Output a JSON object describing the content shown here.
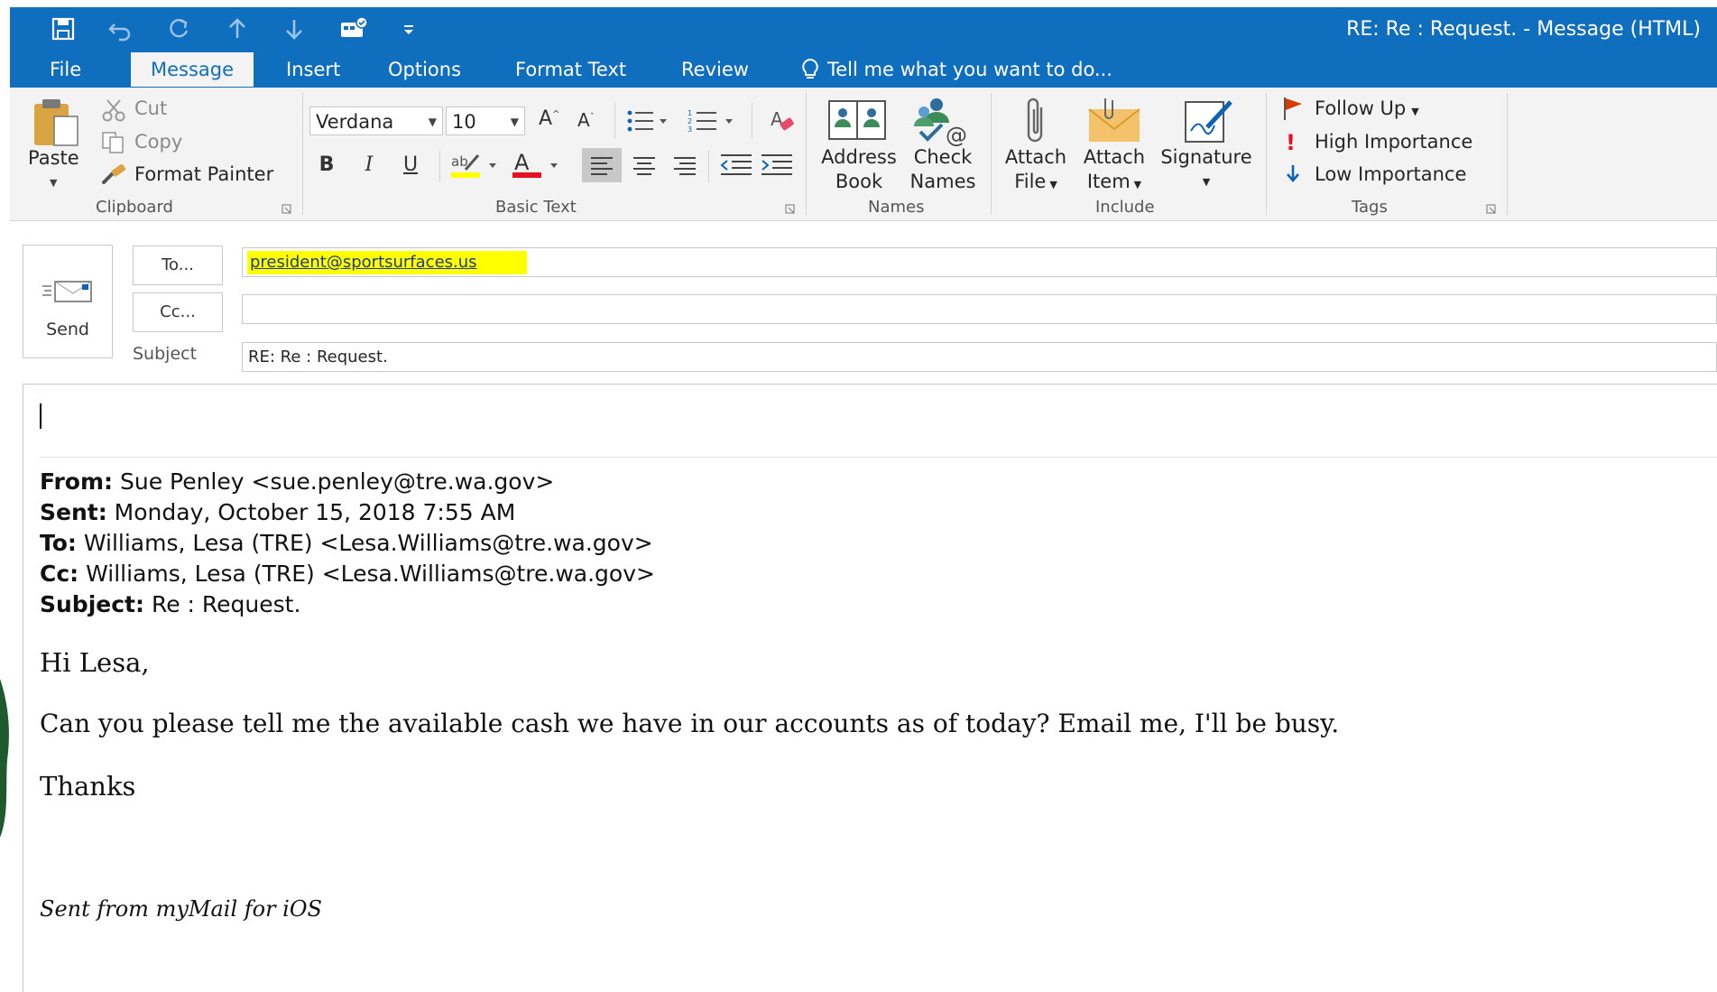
{
  "window": {
    "title": "RE: Re :  Request.  -  Message (HTML)"
  },
  "quick_access": {
    "icons": [
      "save-icon",
      "undo-icon",
      "redo-icon",
      "up-arrow-icon",
      "down-arrow-icon",
      "screenshot-icon",
      "customize-qat-icon"
    ]
  },
  "tabs": [
    {
      "label": "File"
    },
    {
      "label": "Message"
    },
    {
      "label": "Insert"
    },
    {
      "label": "Options"
    },
    {
      "label": "Format Text"
    },
    {
      "label": "Review"
    }
  ],
  "tell_me": "Tell me what you want to do...",
  "ribbon": {
    "clipboard": {
      "label": "Clipboard",
      "paste": "Paste",
      "cut": "Cut",
      "copy": "Copy",
      "format_painter": "Format Painter"
    },
    "basic_text": {
      "label": "Basic Text",
      "font_name": "Verdana",
      "font_size": "10",
      "bold": "B",
      "italic": "I",
      "underline": "U"
    },
    "names": {
      "label": "Names",
      "address_book_line1": "Address",
      "address_book_line2": "Book",
      "check_names_line1": "Check",
      "check_names_line2": "Names"
    },
    "include": {
      "label": "Include",
      "attach_file_line1": "Attach",
      "attach_file_line2": "File",
      "attach_item_line1": "Attach",
      "attach_item_line2": "Item",
      "signature": "Signature"
    },
    "tags": {
      "label": "Tags",
      "follow_up": "Follow Up",
      "high_importance": "High Importance",
      "low_importance": "Low Importance"
    }
  },
  "compose": {
    "send_label": "Send",
    "to_button": "To...",
    "cc_button": "Cc...",
    "subject_label": "Subject",
    "to_value": "president@sportsurfaces.us",
    "cc_value": "",
    "subject_value": "RE: Re :  Request."
  },
  "body": {
    "quoted_header": {
      "from_label": "From:",
      "from_value": " Sue Penley <sue.penley@tre.wa.gov>",
      "sent_label": "Sent:",
      "sent_value": " Monday, October 15, 2018 7:55 AM",
      "to_label": "To:",
      "to_value": " Williams, Lesa (TRE) <Lesa.Williams@tre.wa.gov>",
      "cc_label": "Cc:",
      "cc_value": " Williams, Lesa (TRE) <Lesa.Williams@tre.wa.gov>",
      "subject_label": "Subject:",
      "subject_value": " Re : Request."
    },
    "greeting": "Hi Lesa,",
    "message": "Can you please tell me the available cash we have in our accounts as of today? Email me, I'll be busy.",
    "closing": "Thanks",
    "signature": "Sent from myMail for iOS"
  },
  "colors": {
    "accent": "#106ebe",
    "ribbon_bg": "#f3f3f3",
    "highlight": "#ffff00",
    "font_color_red": "#e81123"
  }
}
